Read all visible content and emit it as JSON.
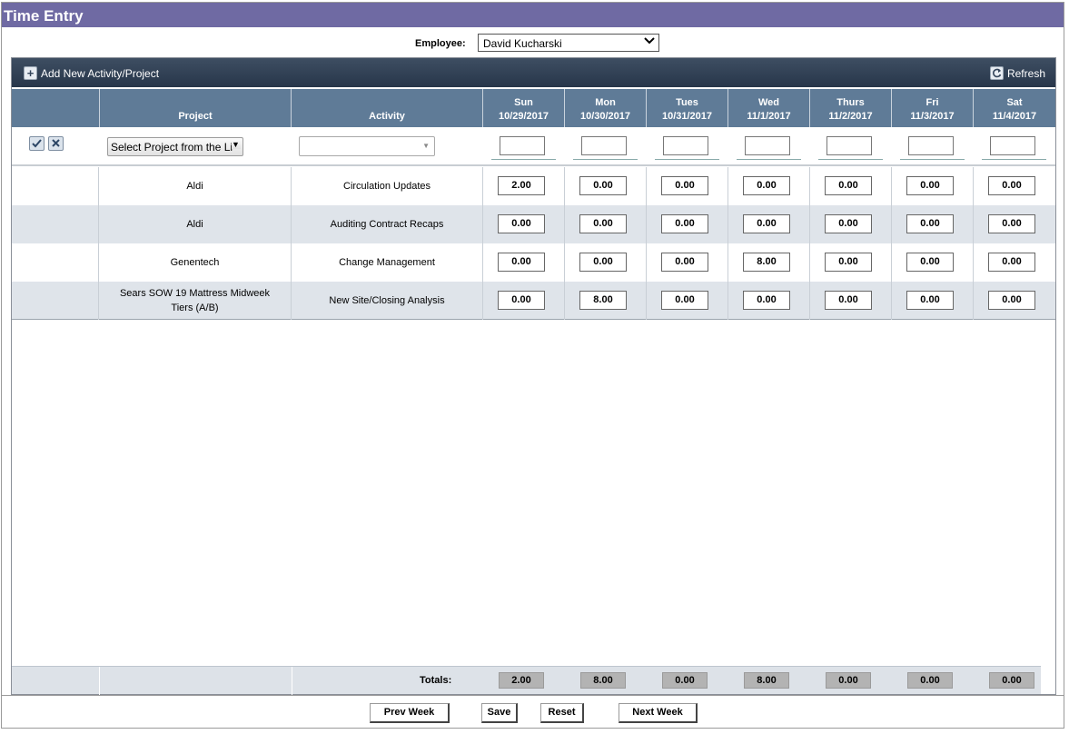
{
  "window": {
    "title": "Time Entry"
  },
  "employee": {
    "label": "Employee:",
    "selected": "David Kucharski"
  },
  "toolbar": {
    "add_label": "Add New Activity/Project",
    "refresh_label": "Refresh"
  },
  "columns": {
    "project": "Project",
    "activity": "Activity",
    "days": [
      {
        "day": "Sun",
        "date": "10/29/2017"
      },
      {
        "day": "Mon",
        "date": "10/30/2017"
      },
      {
        "day": "Tues",
        "date": "10/31/2017"
      },
      {
        "day": "Wed",
        "date": "11/1/2017"
      },
      {
        "day": "Thurs",
        "date": "11/2/2017"
      },
      {
        "day": "Fri",
        "date": "11/3/2017"
      },
      {
        "day": "Sat",
        "date": "11/4/2017"
      }
    ]
  },
  "new_entry": {
    "project_placeholder": "Select Project from the Li",
    "activity_value": "",
    "icons": {
      "confirm": "checkmark-icon",
      "cancel": "close-icon"
    }
  },
  "rows": [
    {
      "project": "Aldi",
      "activity": "Circulation Updates",
      "hours": [
        "2.00",
        "0.00",
        "0.00",
        "0.00",
        "0.00",
        "0.00",
        "0.00"
      ]
    },
    {
      "project": "Aldi",
      "activity": "Auditing Contract Recaps",
      "hours": [
        "0.00",
        "0.00",
        "0.00",
        "0.00",
        "0.00",
        "0.00",
        "0.00"
      ]
    },
    {
      "project": "Genentech",
      "activity": "Change Management",
      "hours": [
        "0.00",
        "0.00",
        "0.00",
        "8.00",
        "0.00",
        "0.00",
        "0.00"
      ]
    },
    {
      "project": "Sears SOW 19 Mattress Midweek Tiers (A/B)",
      "activity": "New Site/Closing Analysis",
      "hours": [
        "0.00",
        "8.00",
        "0.00",
        "0.00",
        "0.00",
        "0.00",
        "0.00"
      ]
    }
  ],
  "totals": {
    "label": "Totals:",
    "values": [
      "2.00",
      "8.00",
      "0.00",
      "8.00",
      "0.00",
      "0.00",
      "0.00"
    ]
  },
  "buttons": {
    "prev_week": "Prev Week",
    "save": "Save",
    "reset": "Reset",
    "next_week": "Next Week"
  },
  "colors": {
    "title_bar": "#6f6aa3",
    "toolbar": "#27364a",
    "header": "#5f7b97",
    "alt_row": "#dfe4ea"
  }
}
